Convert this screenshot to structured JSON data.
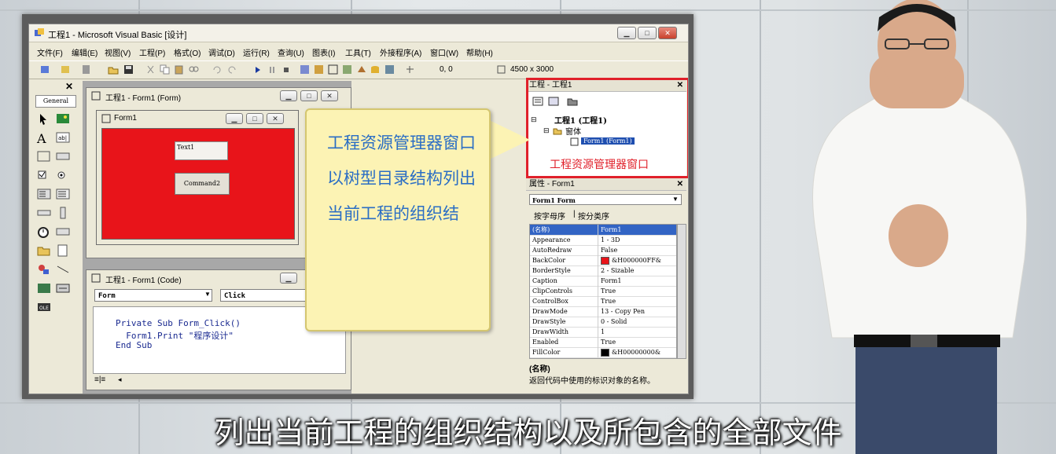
{
  "window": {
    "title": "工程1 - Microsoft Visual Basic [设计]",
    "menu": [
      "文件(F)",
      "编辑(E)",
      "视图(V)",
      "工程(P)",
      "格式(O)",
      "调试(D)",
      "运行(R)",
      "查询(U)",
      "图表(I)",
      "工具(T)",
      "外接程序(A)",
      "窗口(W)",
      "帮助(H)"
    ],
    "coords": "0, 0",
    "size": "4500 x 3000"
  },
  "toolbox": {
    "label": "General"
  },
  "form_designer": {
    "title": "工程1 - Form1 (Form)",
    "form_title": "Form1",
    "textbox_text": "Text1",
    "button_text": "Command2"
  },
  "code_window": {
    "title": "工程1 - Form1 (Code)",
    "object": "Form",
    "procedure": "Click",
    "lines": [
      "Private Sub Form_Click()",
      "  Form1.Print \"程序设计\"",
      "End Sub"
    ]
  },
  "callout": {
    "text": "工程资源管理器窗口以树型目录结构列出当前工程的组织结"
  },
  "project_explorer": {
    "title": "工程 - 工程1",
    "root": "工程1 (工程1)",
    "folder": "窗体",
    "item": "Form1 (Form1)",
    "annotation": "工程资源管理器窗口"
  },
  "properties": {
    "title": "属性 - Form1",
    "object": "Form1 Form",
    "tab_alpha": "按字母序",
    "tab_category": "按分类序",
    "rows": [
      {
        "k": "(名称)",
        "v": "Form1"
      },
      {
        "k": "Appearance",
        "v": "1 - 3D"
      },
      {
        "k": "AutoRedraw",
        "v": "False"
      },
      {
        "k": "BackColor",
        "v": "&H000000FF&"
      },
      {
        "k": "BorderStyle",
        "v": "2 - Sizable"
      },
      {
        "k": "Caption",
        "v": "Form1"
      },
      {
        "k": "ClipControls",
        "v": "True"
      },
      {
        "k": "ControlBox",
        "v": "True"
      },
      {
        "k": "DrawMode",
        "v": "13 - Copy Pen"
      },
      {
        "k": "DrawStyle",
        "v": "0 - Solid"
      },
      {
        "k": "DrawWidth",
        "v": "1"
      },
      {
        "k": "Enabled",
        "v": "True"
      },
      {
        "k": "FillColor",
        "v": "&H00000000&"
      }
    ],
    "desc_title": "(名称)",
    "desc_text": "返回代码中使用的标识对象的名称。"
  },
  "subtitle": "列出当前工程的组织结构以及所包含的全部文件",
  "colors": {
    "form_back": "#e8141a",
    "callout_bg": "#fcf3b4",
    "callout_text": "#2b6ec4",
    "annotation_red": "#e0202a"
  }
}
